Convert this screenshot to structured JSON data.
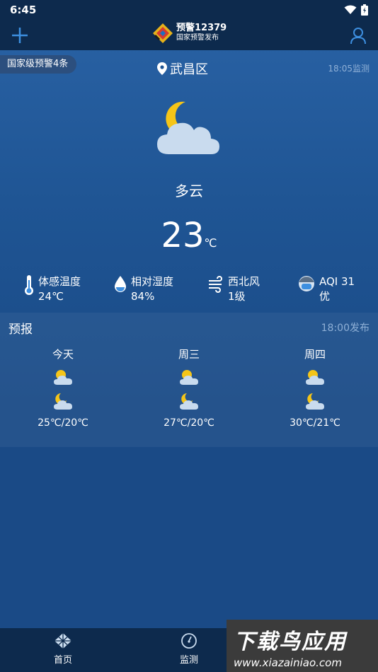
{
  "status_bar": {
    "time": "6:45"
  },
  "app_bar": {
    "brand_title": "预警12379",
    "brand_subtitle": "国家预警发布",
    "add_icon": "plus-icon",
    "profile_icon": "user-icon"
  },
  "alert": {
    "label": "国家级预警4条"
  },
  "location": {
    "name": "武昌区",
    "monitor_time": "18:05监测"
  },
  "current": {
    "condition": "多云",
    "temperature": "23",
    "unit": "℃",
    "icon": "partly-cloudy-night-icon"
  },
  "details": [
    {
      "label": "体感温度",
      "value": "24℃",
      "icon": "thermometer-icon"
    },
    {
      "label": "相对湿度",
      "value": "84%",
      "icon": "humidity-drop-icon"
    },
    {
      "label": "西北风",
      "value": "1级",
      "icon": "wind-icon"
    },
    {
      "label": "AQI 31",
      "value": "优",
      "icon": "mask-face-icon"
    }
  ],
  "forecast": {
    "title": "预报",
    "publish_time": "18:00发布",
    "days": [
      {
        "name": "今天",
        "temp": "25℃/20℃"
      },
      {
        "name": "周三",
        "temp": "27℃/20℃"
      },
      {
        "name": "周四",
        "temp": "30℃/21℃"
      }
    ]
  },
  "nav": {
    "items": [
      {
        "label": "首页",
        "icon": "map-grid-icon"
      },
      {
        "label": "监测",
        "icon": "gauge-icon"
      }
    ]
  },
  "watermark": {
    "main": "下载鸟应用",
    "url": "www.xiazainiao.com"
  },
  "colors": {
    "background": "#1f5594",
    "bar": "#0d2a4d",
    "accent": "#3d8fe0",
    "muted": "#8fb0d6"
  }
}
